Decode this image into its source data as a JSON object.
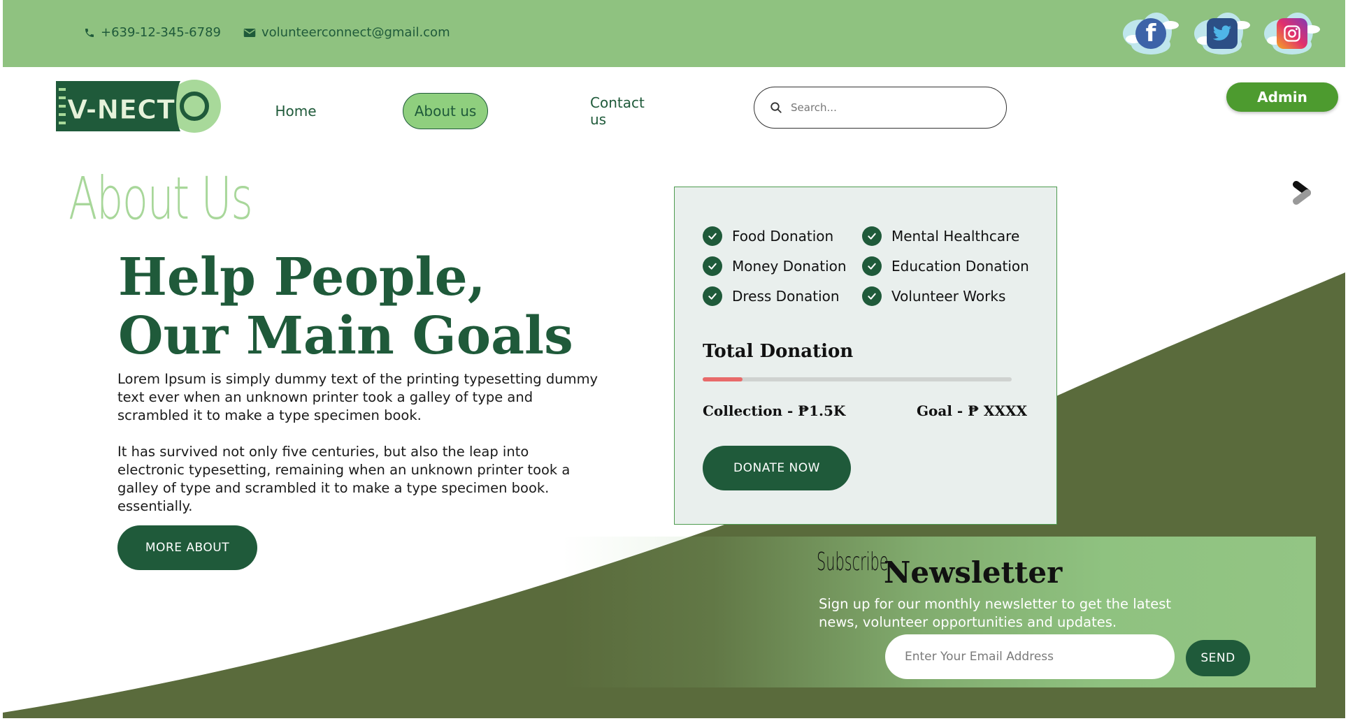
{
  "topbar": {
    "phone": "+639-12-345-6789",
    "email": "volunteerconnect@gmail.com",
    "social": [
      "facebook-icon",
      "twitter-icon",
      "instagram-icon"
    ]
  },
  "logo": {
    "text": "V-NECT"
  },
  "nav": {
    "home": "Home",
    "about": "About us",
    "contact": "Contact us",
    "search_placeholder": "Search...",
    "admin": "Admin"
  },
  "hero": {
    "section_title": "About Us",
    "headline_line1": "Help People,",
    "headline_line2": "Our Main Goals",
    "para1": "Lorem Ipsum is simply dummy text of the printing typesetting dummy text ever  when an unknown printer took a galley of type and scrambled it to make a type specimen book.",
    "para2": "It has survived not only five centuries, but also the leap into electronic typesetting, remaining when an unknown printer took a galley of type and scrambled it to make a type specimen book. essentially.",
    "more_button": "MORE ABOUT"
  },
  "donation": {
    "categories_left": [
      "Food Donation",
      "Money Donation",
      "Dress Donation"
    ],
    "categories_right": [
      "Mental Healthcare",
      "Education Donation",
      "Volunteer Works"
    ],
    "total_title": "Total Donation",
    "progress": 0.13,
    "collection": "Collection - ₱1.5K",
    "goal": "Goal - ₱ XXXX",
    "donate_button": "DONATE NOW"
  },
  "newsletter": {
    "subscribe": "Subscribe",
    "title": "Newsletter",
    "description": "Sign up for our monthly newsletter to get the latest news, volunteer opportunities and updates.",
    "email_placeholder": "Enter Your Email Address",
    "send_button": "SEND"
  },
  "colors": {
    "topbar": "#8fc280",
    "primary_dark": "#1f5a3a",
    "olive": "#5a6b3c",
    "admin": "#4d9b2f",
    "progress": "#e86a6a"
  }
}
